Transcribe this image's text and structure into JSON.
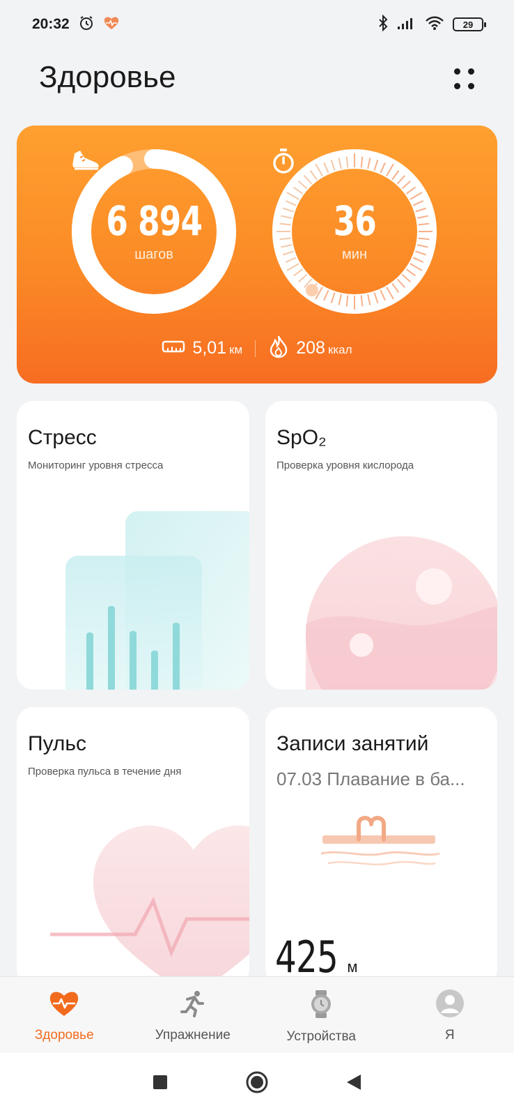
{
  "status_bar": {
    "time": "20:32",
    "battery": "29",
    "icons": [
      "alarm-icon",
      "health-heart-icon",
      "bluetooth-icon",
      "signal-icon",
      "wifi-icon",
      "battery-icon"
    ]
  },
  "header": {
    "title": "Здоровье",
    "menu_icon": "grid-dots-icon"
  },
  "activity": {
    "steps": {
      "value": "6 894",
      "unit": "шагов",
      "progress": 0.93,
      "icon": "sneaker-icon"
    },
    "minutes": {
      "value": "36",
      "unit": "мин",
      "progress": 0.6,
      "icon": "stopwatch-icon"
    },
    "distance": {
      "value": "5,01",
      "unit": "км",
      "icon": "ruler-icon"
    },
    "calories": {
      "value": "208",
      "unit": "ккал",
      "icon": "flame-icon"
    }
  },
  "tiles": {
    "stress": {
      "title": "Стресс",
      "subtitle": "Мониторинг уровня стресса"
    },
    "spo2": {
      "title": "SpO₂",
      "subtitle": "Проверка уровня кислорода"
    },
    "pulse": {
      "title": "Пульс",
      "subtitle": "Проверка пульса в течение дня"
    },
    "workouts": {
      "title": "Записи занятий",
      "subtitle": "07.03 Плавание в ба...",
      "value": "425",
      "unit": "м"
    }
  },
  "tab_bar": {
    "items": [
      {
        "label": "Здоровье",
        "icon": "heart-pulse-icon",
        "active": true
      },
      {
        "label": "Упражнение",
        "icon": "runner-icon",
        "active": false
      },
      {
        "label": "Устройства",
        "icon": "watch-icon",
        "active": false
      },
      {
        "label": "Я",
        "icon": "avatar-icon",
        "active": false
      }
    ]
  },
  "colors": {
    "accent": "#f26b1d",
    "card_top": "#ffa030",
    "card_bottom": "#f76d22"
  }
}
